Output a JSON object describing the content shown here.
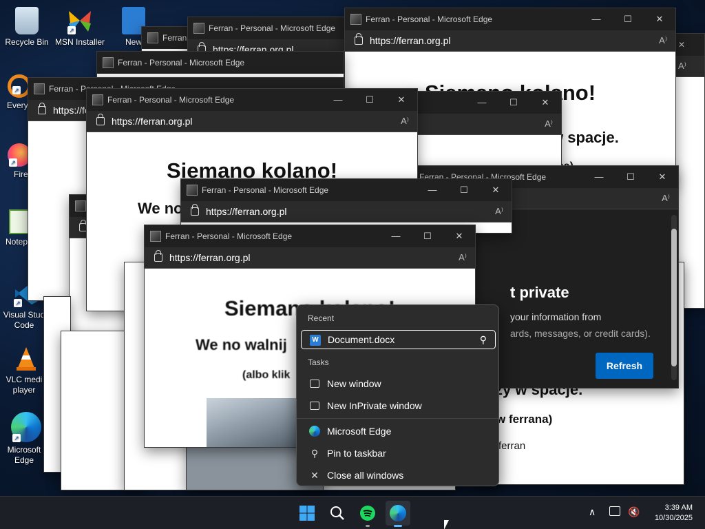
{
  "desktop": {
    "icons": [
      {
        "label": "Recycle Bin"
      },
      {
        "label": "MSN Installer"
      },
      {
        "label": "New"
      },
      {
        "label": "Everyt"
      },
      {
        "label": "Fire"
      },
      {
        "label": "Notep"
      },
      {
        "label": "Visual Stud Code"
      },
      {
        "label": "VLC medi player"
      },
      {
        "label": "Microsoft Edge"
      }
    ]
  },
  "window": {
    "title": "Ferran - Personal - Microsoft Edge",
    "short_title": "Ferran",
    "url": "https://ferran.org.pl",
    "min": "—",
    "max": "☐",
    "close": "✕",
    "read_aloud": "A⁾"
  },
  "page": {
    "heading": "Siemano kolano!",
    "line2": "We no walnij",
    "line2_short": "We no",
    "spacje": "w spacje.",
    "spacje_alt": "zy w spacje.",
    "albo": "(albo klik",
    "ferrana_close": "na)",
    "ferrana": "w ferrana)",
    "ferran": "ferran"
  },
  "private_dialog": {
    "title": "t private",
    "text1": "your information from",
    "text2": "ards, messages, or credit cards).",
    "button": "Refresh"
  },
  "jumplist": {
    "recent_header": "Recent",
    "recent_item": "Document.docx",
    "tasks_header": "Tasks",
    "new_window": "New window",
    "inprivate": "New InPrivate window",
    "edge": "Microsoft Edge",
    "pin": "Pin to taskbar",
    "close_all": "Close all windows"
  },
  "taskbar": {
    "time": "3:39 AM",
    "date": "10/30/2025",
    "chevron": "∧"
  },
  "colors": {
    "accent": "#0067c0",
    "edge_blue": "#0f7bd8",
    "spotify": "#1ed760",
    "dark": "#202020"
  }
}
